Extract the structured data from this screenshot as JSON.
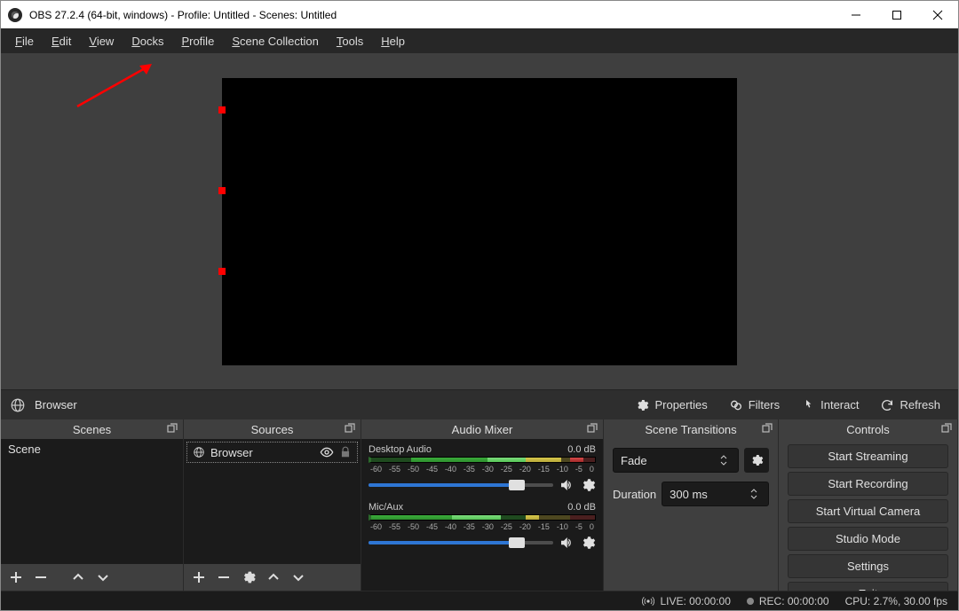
{
  "title": "OBS 27.2.4 (64-bit, windows) - Profile: Untitled - Scenes: Untitled",
  "menubar": [
    "File",
    "Edit",
    "View",
    "Docks",
    "Profile",
    "Scene Collection",
    "Tools",
    "Help"
  ],
  "context": {
    "source_label": "Browser",
    "buttons": {
      "properties": "Properties",
      "filters": "Filters",
      "interact": "Interact",
      "refresh": "Refresh"
    }
  },
  "docks": {
    "scenes": {
      "title": "Scenes",
      "items": [
        "Scene"
      ]
    },
    "sources": {
      "title": "Sources",
      "items": [
        "Browser"
      ]
    },
    "mixer": {
      "title": "Audio Mixer",
      "ticks": [
        "-60",
        "-55",
        "-50",
        "-45",
        "-40",
        "-35",
        "-30",
        "-25",
        "-20",
        "-15",
        "-10",
        "-5",
        "0"
      ],
      "channels": [
        {
          "name": "Desktop Audio",
          "db": "0.0 dB"
        },
        {
          "name": "Mic/Aux",
          "db": "0.0 dB"
        }
      ]
    },
    "transitions": {
      "title": "Scene Transitions",
      "current": "Fade",
      "duration_label": "Duration",
      "duration_value": "300 ms"
    },
    "controls": {
      "title": "Controls",
      "buttons": {
        "stream": "Start Streaming",
        "record": "Start Recording",
        "vcam": "Start Virtual Camera",
        "studio": "Studio Mode",
        "settings": "Settings",
        "exit": "Exit"
      }
    }
  },
  "status": {
    "live": "LIVE: 00:00:00",
    "rec": "REC: 00:00:00",
    "cpu": "CPU: 2.7%, 30.00 fps"
  }
}
